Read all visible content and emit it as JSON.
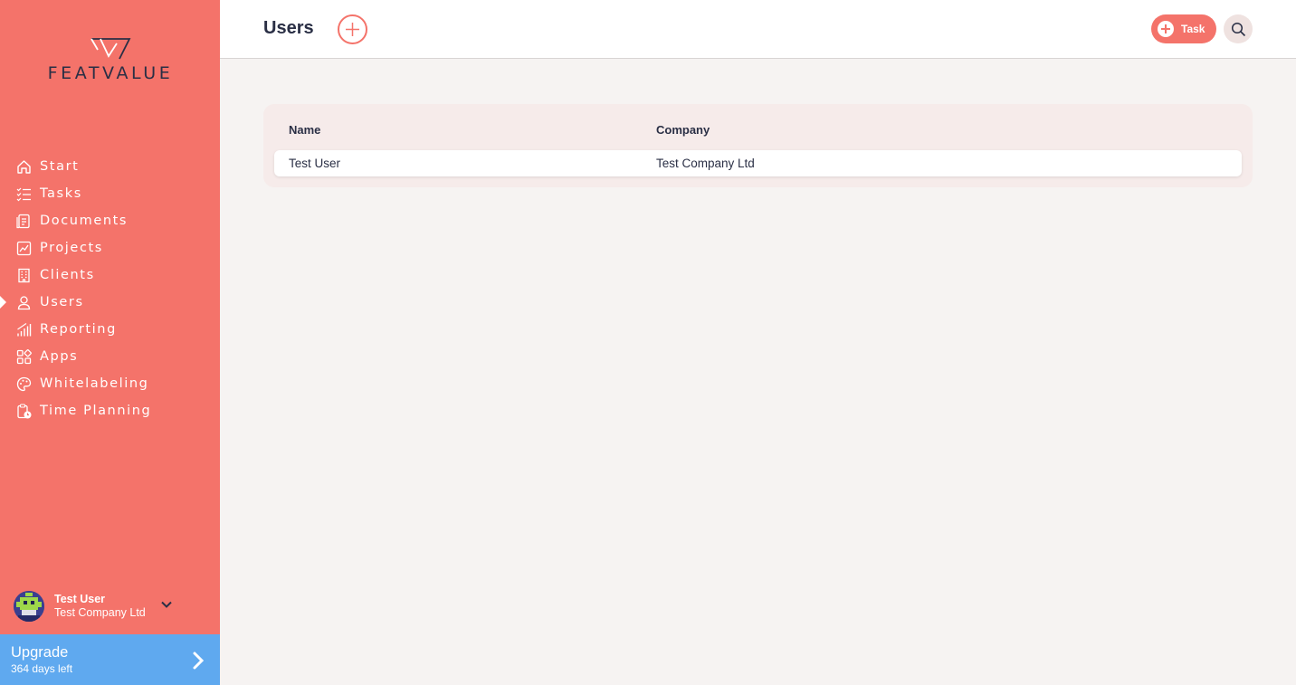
{
  "brand": {
    "name": "FEATVALUE"
  },
  "colors": {
    "sidebar": "#f4736a",
    "accent": "#f4736a",
    "upgrade": "#5fa9ef",
    "text_dark": "#2a2f45"
  },
  "nav": {
    "items": [
      {
        "label": "Start",
        "icon": "home-icon"
      },
      {
        "label": "Tasks",
        "icon": "checklist-icon"
      },
      {
        "label": "Documents",
        "icon": "document-icon"
      },
      {
        "label": "Projects",
        "icon": "chart-icon"
      },
      {
        "label": "Clients",
        "icon": "building-icon"
      },
      {
        "label": "Users",
        "icon": "user-icon",
        "active": true
      },
      {
        "label": "Reporting",
        "icon": "bar-chart-icon"
      },
      {
        "label": "Apps",
        "icon": "apps-icon"
      },
      {
        "label": "Whitelabeling",
        "icon": "palette-icon"
      },
      {
        "label": "Time Planning",
        "icon": "clipboard-clock-icon"
      }
    ]
  },
  "user": {
    "name": "Test User",
    "company": "Test Company Ltd"
  },
  "upgrade": {
    "title": "Upgrade",
    "subtitle": "364 days left"
  },
  "header": {
    "title": "Users",
    "task_label": "Task"
  },
  "table": {
    "columns": [
      "Name",
      "Company"
    ],
    "rows": [
      {
        "name": "Test User",
        "company": "Test Company Ltd"
      }
    ]
  }
}
